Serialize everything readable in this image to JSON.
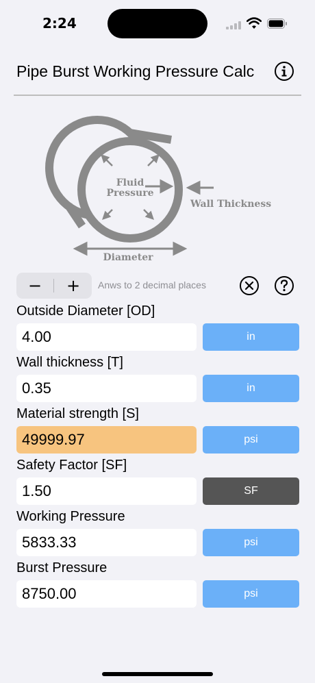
{
  "status_bar": {
    "time": "2:24"
  },
  "header": {
    "title": "Pipe Burst Working Pressure Calc"
  },
  "diagram": {
    "fluid_pressure_label_line1": "Fluid",
    "fluid_pressure_label_line2": "Pressure",
    "wall_thickness_label": "Wall Thickness",
    "diameter_label": "Diameter"
  },
  "controls": {
    "decrement_label": "−",
    "increment_label": "+",
    "decimals_text": "Anws to 2 decimal places"
  },
  "fields": {
    "outside_diameter": {
      "label": "Outside Diameter [OD]",
      "value": "4.00",
      "unit": "in"
    },
    "wall_thickness": {
      "label": "Wall thickness [T]",
      "value": "0.35",
      "unit": "in"
    },
    "material_strength": {
      "label": "Material strength [S]",
      "value": "49999.97",
      "unit": "psi"
    },
    "safety_factor": {
      "label": "Safety Factor [SF]",
      "value": "1.50",
      "unit": "SF"
    },
    "working_pressure": {
      "label": "Working Pressure",
      "value": "5833.33",
      "unit": "psi"
    },
    "burst_pressure": {
      "label": "Burst Pressure",
      "value": "8750.00",
      "unit": "psi"
    }
  },
  "colors": {
    "unit_button": "#6bb0f8",
    "unit_button_dark": "#555555",
    "highlight_field": "#f7c47f",
    "background": "#f2f2f7"
  }
}
